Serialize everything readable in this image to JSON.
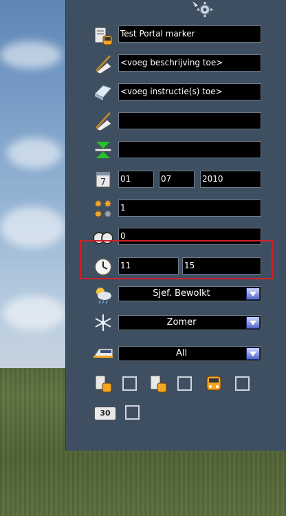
{
  "form": {
    "name": "Test Portal marker",
    "description": "<voeg beschrijving toe>",
    "instructions": "<voeg instructie(s) toe>",
    "empty_field_1": "",
    "empty_field_2": "",
    "date_day": "01",
    "date_month": "07",
    "date_year": "2010",
    "rating": "1",
    "count": "0",
    "time_hour": "11",
    "time_minute": "15",
    "weather": "Sjef. Bewolkt",
    "season": "Zomer",
    "train_filter": "All",
    "speed_badge": "30"
  },
  "icons": {
    "top": "gear-icon",
    "name": "timetable-icon",
    "description": "pen-icon",
    "instructions": "instruction-icon",
    "edit": "pen-icon",
    "marker": "marker-icon",
    "date": "calendar-icon",
    "rating": "stars-icon",
    "count": "counter-icon",
    "time": "clock-icon",
    "weather": "weather-icon",
    "season": "snowflake-icon",
    "train": "train-icon"
  },
  "colors": {
    "highlight": "#d0202a",
    "panel": "#3f4f62",
    "field_bg": "#000000",
    "accent": "#f5a623"
  }
}
